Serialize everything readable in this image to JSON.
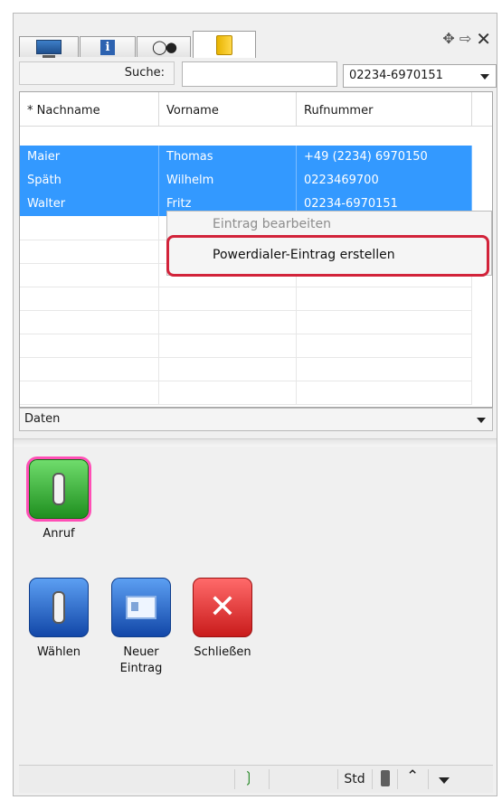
{
  "tabs": [
    {
      "icon": "monitor-icon"
    },
    {
      "icon": "info-icon"
    },
    {
      "icon": "glasses-icon"
    },
    {
      "icon": "address-book-icon",
      "active": true
    }
  ],
  "search": {
    "label": "Suche:",
    "value": ""
  },
  "number_select": {
    "value": "02234-6970151"
  },
  "table": {
    "headers": [
      "* Nachname",
      "Vorname",
      "Rufnummer"
    ],
    "rows": [
      {
        "nachname": "Maier",
        "vorname": "Thomas",
        "rufnummer": "+49 (2234) 6970150"
      },
      {
        "nachname": "Späth",
        "vorname": "Wilhelm",
        "rufnummer": "0223469700"
      },
      {
        "nachname": "Walter",
        "vorname": "Fritz",
        "rufnummer": "02234-6970151"
      }
    ]
  },
  "context_menu": {
    "items": [
      "Eintrag bearbeiten",
      "Powerdialer-Eintrag erstellen"
    ]
  },
  "data_dropdown": {
    "label": "Daten"
  },
  "actions": {
    "anruf": "Anruf",
    "waehlen": "Wählen",
    "neuer_eintrag_1": "Neuer",
    "neuer_eintrag_2": "Eintrag",
    "schliessen": "Schließen"
  },
  "statusbar": {
    "std": "Std"
  },
  "colors": {
    "selection": "#3399ff",
    "highlight_ring": "#d2233a",
    "anruf_border": "#ff4fb6"
  }
}
